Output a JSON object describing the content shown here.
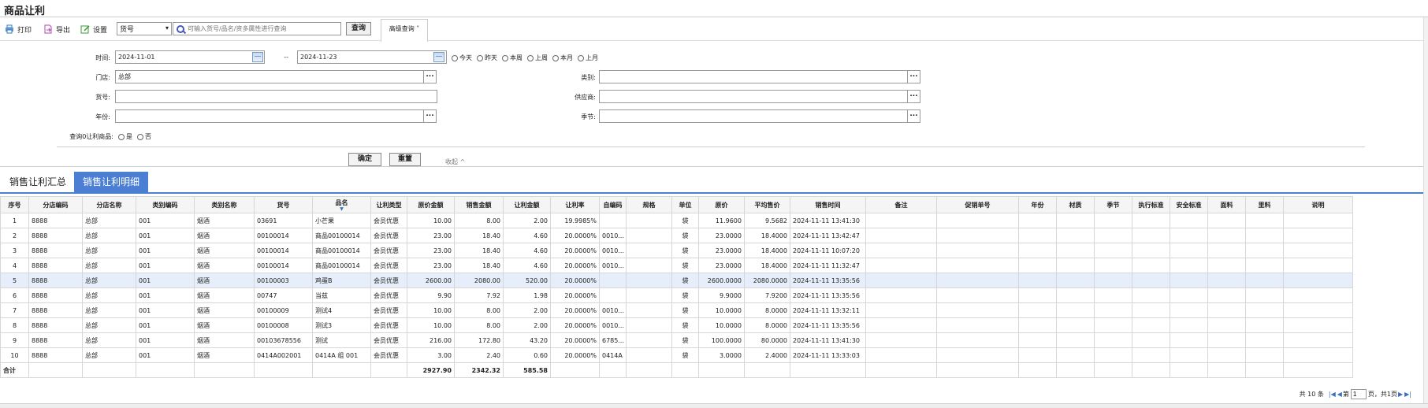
{
  "title": "商品让利",
  "toolbar": {
    "print": "打印",
    "export": "导出",
    "settings": "设置",
    "field_select": "货号",
    "search_placeholder": "可输入货号/品名/资多属性进行查询",
    "query": "查询",
    "advanced": "高级查询"
  },
  "filter": {
    "time_label": "时间:",
    "date_from": "2024-11-01",
    "date_sep": "--",
    "date_to": "2024-11-23",
    "ranges": [
      "今天",
      "昨天",
      "本周",
      "上周",
      "本月",
      "上月"
    ],
    "store_label": "门店:",
    "store_value": "总部",
    "category_label": "类别:",
    "sku_label": "货号:",
    "supplier_label": "供应商:",
    "year_label": "年份:",
    "season_label": "季节:",
    "zero_label": "查询0让利商品:",
    "zero_yes": "是",
    "zero_no": "否",
    "confirm": "确定",
    "reset": "重置",
    "collapse": "收起 ^"
  },
  "tabs": {
    "summary": "销售让利汇总",
    "detail": "销售让利明细"
  },
  "table": {
    "columns": [
      "序号",
      "分店编码",
      "分店名称",
      "类别编码",
      "类别名称",
      "货号",
      "品名",
      "让利类型",
      "原价金额",
      "销售金额",
      "让利金额",
      "让利率",
      "自编码",
      "规格",
      "单位",
      "原价",
      "平均售价",
      "销售时间",
      "备注",
      "促销单号",
      "年份",
      "材质",
      "季节",
      "执行标准",
      "安全标准",
      "面料",
      "里料",
      "说明"
    ],
    "rows": [
      [
        "1",
        "8888",
        "总部",
        "001",
        "烟酒",
        "03691",
        "小芒果",
        "会员优惠",
        "10.00",
        "8.00",
        "2.00",
        "19.9985%",
        "",
        "",
        "袋",
        "11.9600",
        "9.5682",
        "2024-11-11 13:41:30",
        "",
        "",
        "",
        "",
        "",
        "",
        "",
        "",
        "",
        ""
      ],
      [
        "2",
        "8888",
        "总部",
        "001",
        "烟酒",
        "00100014",
        "商品00100014",
        "会员优惠",
        "23.00",
        "18.40",
        "4.60",
        "20.0000%",
        "0010...",
        "",
        "袋",
        "23.0000",
        "18.4000",
        "2024-11-11 13:42:47",
        "",
        "",
        "",
        "",
        "",
        "",
        "",
        "",
        "",
        ""
      ],
      [
        "3",
        "8888",
        "总部",
        "001",
        "烟酒",
        "00100014",
        "商品00100014",
        "会员优惠",
        "23.00",
        "18.40",
        "4.60",
        "20.0000%",
        "0010...",
        "",
        "袋",
        "23.0000",
        "18.4000",
        "2024-11-11 10:07:20",
        "",
        "",
        "",
        "",
        "",
        "",
        "",
        "",
        "",
        ""
      ],
      [
        "4",
        "8888",
        "总部",
        "001",
        "烟酒",
        "00100014",
        "商品00100014",
        "会员优惠",
        "23.00",
        "18.40",
        "4.60",
        "20.0000%",
        "0010...",
        "",
        "袋",
        "23.0000",
        "18.4000",
        "2024-11-11 11:32:47",
        "",
        "",
        "",
        "",
        "",
        "",
        "",
        "",
        "",
        ""
      ],
      [
        "5",
        "8888",
        "总部",
        "001",
        "烟酒",
        "00100003",
        "鸡蛋B",
        "会员优惠",
        "2600.00",
        "2080.00",
        "520.00",
        "20.0000%",
        "",
        "",
        "袋",
        "2600.0000",
        "2080.0000",
        "2024-11-11 13:35:56",
        "",
        "",
        "",
        "",
        "",
        "",
        "",
        "",
        "",
        ""
      ],
      [
        "6",
        "8888",
        "总部",
        "001",
        "烟酒",
        "00747",
        "当兹",
        "会员优惠",
        "9.90",
        "7.92",
        "1.98",
        "20.0000%",
        "",
        "",
        "袋",
        "9.9000",
        "7.9200",
        "2024-11-11 13:35:56",
        "",
        "",
        "",
        "",
        "",
        "",
        "",
        "",
        "",
        ""
      ],
      [
        "7",
        "8888",
        "总部",
        "001",
        "烟酒",
        "00100009",
        "测试4",
        "会员优惠",
        "10.00",
        "8.00",
        "2.00",
        "20.0000%",
        "0010...",
        "",
        "袋",
        "10.0000",
        "8.0000",
        "2024-11-11 13:32:11",
        "",
        "",
        "",
        "",
        "",
        "",
        "",
        "",
        "",
        ""
      ],
      [
        "8",
        "8888",
        "总部",
        "001",
        "烟酒",
        "00100008",
        "测试3",
        "会员优惠",
        "10.00",
        "8.00",
        "2.00",
        "20.0000%",
        "0010...",
        "",
        "袋",
        "10.0000",
        "8.0000",
        "2024-11-11 13:35:56",
        "",
        "",
        "",
        "",
        "",
        "",
        "",
        "",
        "",
        ""
      ],
      [
        "9",
        "8888",
        "总部",
        "001",
        "烟酒",
        "00103678556",
        "测试",
        "会员优惠",
        "216.00",
        "172.80",
        "43.20",
        "20.0000%",
        "6785...",
        "",
        "袋",
        "100.0000",
        "80.0000",
        "2024-11-11 13:41:30",
        "",
        "",
        "",
        "",
        "",
        "",
        "",
        "",
        "",
        ""
      ],
      [
        "10",
        "8888",
        "总部",
        "001",
        "烟酒",
        "0414A002001",
        "0414A 组 001",
        "会员优惠",
        "3.00",
        "2.40",
        "0.60",
        "20.0000%",
        "0414A",
        "",
        "袋",
        "3.0000",
        "2.4000",
        "2024-11-11 13:33:03",
        "",
        "",
        "",
        "",
        "",
        "",
        "",
        "",
        "",
        ""
      ]
    ],
    "total_label": "合计",
    "totals": {
      "orig": "2927.90",
      "sale": "2342.32",
      "discount": "585.58"
    }
  },
  "pager": {
    "total": "共 10 条",
    "page_prefix": "第",
    "page": "1",
    "page_suffix": "页，共1页"
  },
  "colors": {
    "accent": "#4a7fd4",
    "selected_row": "#e6eefb"
  }
}
